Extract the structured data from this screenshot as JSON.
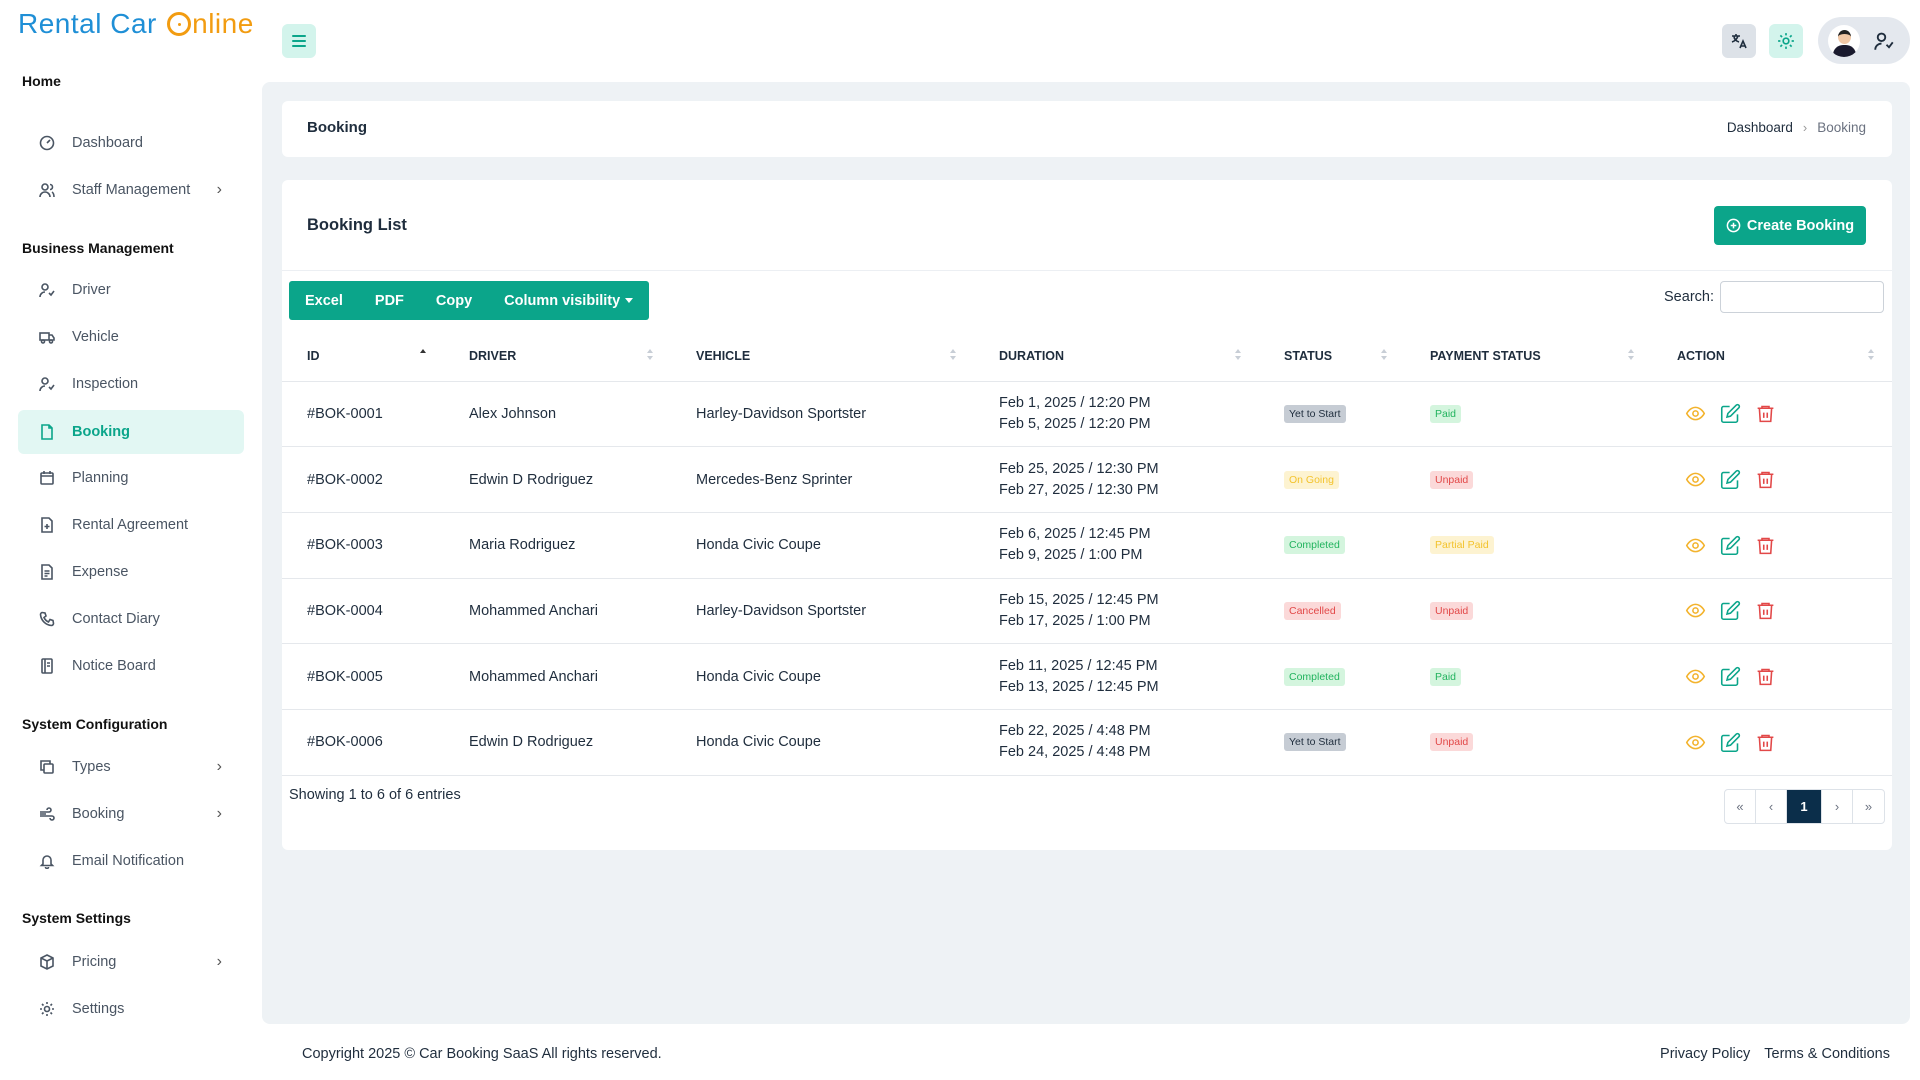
{
  "app": {
    "logo_part1": "Rental Car ",
    "logo_part2": "nline"
  },
  "sidebar": {
    "section_home": "Home",
    "dashboard": "Dashboard",
    "staff_management": "Staff Management",
    "section_business": "Business Management",
    "driver": "Driver",
    "vehicle": "Vehicle",
    "inspection": "Inspection",
    "booking": "Booking",
    "planning": "Planning",
    "rental_agreement": "Rental Agreement",
    "expense": "Expense",
    "contact_diary": "Contact Diary",
    "notice_board": "Notice Board",
    "section_system_config": "System Configuration",
    "types": "Types",
    "booking_config": "Booking",
    "email_notification": "Email Notification",
    "section_system_settings": "System Settings",
    "pricing": "Pricing",
    "settings": "Settings"
  },
  "header": {
    "page_title": "Booking",
    "breadcrumb_home": "Dashboard",
    "breadcrumb_current": "Booking"
  },
  "list": {
    "title": "Booking List",
    "create_button": "Create Booking",
    "export_excel": "Excel",
    "export_pdf": "PDF",
    "export_copy": "Copy",
    "column_visibility": "Column visibility",
    "search_label": "Search:",
    "search_value": "",
    "columns": [
      "ID",
      "Driver",
      "Vehicle",
      "Duration",
      "Status",
      "Payment Status",
      "Action"
    ],
    "rows": [
      {
        "id": "#BOK-0001",
        "driver": "Alex Johnson",
        "vehicle": "Harley-Davidson Sportster",
        "start": "Feb 1, 2025 / 12:20 PM",
        "end": "Feb 5, 2025 / 12:20 PM",
        "status": "Yet to Start",
        "payment": "Paid"
      },
      {
        "id": "#BOK-0002",
        "driver": "Edwin D Rodriguez",
        "vehicle": "Mercedes-Benz Sprinter",
        "start": "Feb 25, 2025 / 12:30 PM",
        "end": "Feb 27, 2025 / 12:30 PM",
        "status": "On Going",
        "payment": "Unpaid"
      },
      {
        "id": "#BOK-0003",
        "driver": "Maria Rodriguez",
        "vehicle": "Honda Civic Coupe",
        "start": "Feb 6, 2025 / 12:45 PM",
        "end": "Feb 9, 2025 / 1:00 PM",
        "status": "Completed",
        "payment": "Partial Paid"
      },
      {
        "id": "#BOK-0004",
        "driver": "Mohammed Anchari",
        "vehicle": "Harley-Davidson Sportster",
        "start": "Feb 15, 2025 / 12:45 PM",
        "end": "Feb 17, 2025 / 1:00 PM",
        "status": "Cancelled",
        "payment": "Unpaid"
      },
      {
        "id": "#BOK-0005",
        "driver": "Mohammed Anchari",
        "vehicle": "Honda Civic Coupe",
        "start": "Feb 11, 2025 / 12:45 PM",
        "end": "Feb 13, 2025 / 12:45 PM",
        "status": "Completed",
        "payment": "Paid"
      },
      {
        "id": "#BOK-0006",
        "driver": "Edwin D Rodriguez",
        "vehicle": "Honda Civic Coupe",
        "start": "Feb 22, 2025 / 4:48 PM",
        "end": "Feb 24, 2025 / 4:48 PM",
        "status": "Yet to Start",
        "payment": "Unpaid"
      }
    ],
    "showing_text": "Showing 1 to 6 of 6 entries",
    "pager": {
      "first": "«",
      "prev": "‹",
      "current": "1",
      "next": "›",
      "last": "»"
    }
  },
  "footer": {
    "copyright": "Copyright 2025 © Car Booking SaaS All rights reserved.",
    "privacy": "Privacy Policy",
    "terms": "Terms & Conditions"
  },
  "colors": {
    "accent": "#0ba58a",
    "view_icon": "#f3b32d",
    "edit_icon": "#0ba58a",
    "delete_icon": "#e24848"
  },
  "icons": {
    "view": "eye-icon",
    "edit": "edit-icon",
    "delete": "trash-icon"
  }
}
